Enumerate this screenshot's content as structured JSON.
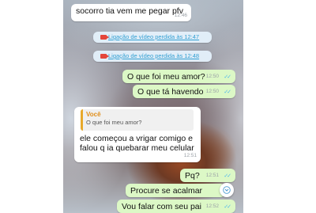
{
  "messages": [
    {
      "direction": "in",
      "text": "socorro tia vem me pegar pfv",
      "time": "12:46"
    },
    {
      "type": "missed-call",
      "text": "Ligação de vídeo perdida às 12:47"
    },
    {
      "type": "missed-call",
      "text": "Ligação de vídeo perdida às 12:48"
    },
    {
      "direction": "out",
      "text": "O que foi meu amor?",
      "time": "12:50"
    },
    {
      "direction": "out",
      "text": "O que tá havendo",
      "time": "12:50"
    },
    {
      "direction": "in",
      "quote_author": "Você",
      "quote_text": "O que foi meu amor?",
      "line1": "ele começou a vrigar comigo e",
      "line2": "falou q ia quebarar meu celular",
      "time": "12:51"
    },
    {
      "direction": "out",
      "text": "Pq?",
      "time": "12:51"
    },
    {
      "direction": "out",
      "text": "Procure se acalmar",
      "time": "12:52"
    },
    {
      "direction": "out",
      "text": "Vou falar com seu pai",
      "time": "12:52"
    }
  ],
  "icons": {
    "read_receipt": "double-check-icon",
    "missed_call": "video-camera-icon",
    "scroll": "chevron-down-icon"
  },
  "colors": {
    "outgoing_bubble": "#dcf8c6",
    "incoming_bubble": "#ffffff",
    "read_ticks": "#4fb6ec",
    "missed_call_link": "#34a0d3",
    "quote_accent": "#e7a92b"
  }
}
